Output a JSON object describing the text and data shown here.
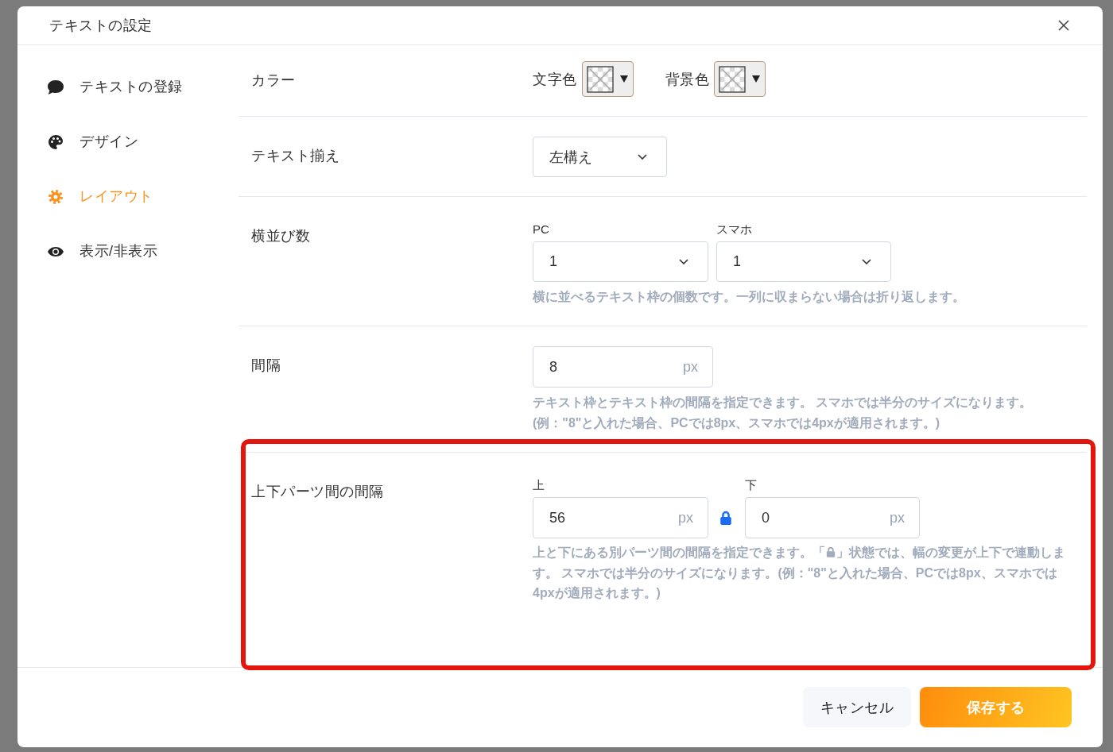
{
  "dialog": {
    "title": "テキストの設定"
  },
  "sidebar": {
    "items": [
      {
        "label": "テキストの登録",
        "selected": false
      },
      {
        "label": "デザイン",
        "selected": false
      },
      {
        "label": "レイアウト",
        "selected": true
      },
      {
        "label": "表示/非表示",
        "selected": false
      }
    ]
  },
  "sections": [
    {
      "kind": "color",
      "label": "カラー",
      "highlighted": false,
      "pickers": [
        {
          "label": "文字色"
        },
        {
          "label": "背景色"
        }
      ]
    },
    {
      "kind": "select",
      "label": "テキスト揃え",
      "highlighted": false,
      "value": "左構え"
    },
    {
      "kind": "columns",
      "label": "横並び数",
      "highlighted": false,
      "fields": [
        {
          "label": "PC",
          "value": "1"
        },
        {
          "label": "スマホ",
          "value": "1"
        }
      ],
      "help": [
        "横に並べるテキスト枠の個数です。一列に収まらない場合は折り返します。"
      ]
    },
    {
      "kind": "number",
      "label": "間隔",
      "highlighted": false,
      "value": "8",
      "unit": "px",
      "help": [
        "テキスト枠とテキスト枠の間隔を指定できます。 スマホでは半分のサイズになります。",
        "(例：\"8\"と入れた場合、PCでは8px、スマホでは4pxが適用されます。)"
      ]
    },
    {
      "kind": "margins",
      "label": "上下パーツ間の間隔",
      "highlighted": true,
      "locked": true,
      "fields": [
        {
          "label": "上",
          "value": "56",
          "unit": "px"
        },
        {
          "label": "下",
          "value": "0",
          "unit": "px"
        }
      ],
      "help_before": "上と下にある別パーツ間の間隔を指定できます。「",
      "help_after": "」状態では、幅の変更が上下で連動します。 スマホでは半分のサイズになります。(例：\"8\"と入れた場合、PCでは8px、スマホでは4pxが適用されます。)"
    }
  ],
  "footer": {
    "buttons": [
      {
        "label": "キャンセル",
        "kind": "secondary"
      },
      {
        "label": "保存する",
        "kind": "primary"
      }
    ]
  }
}
